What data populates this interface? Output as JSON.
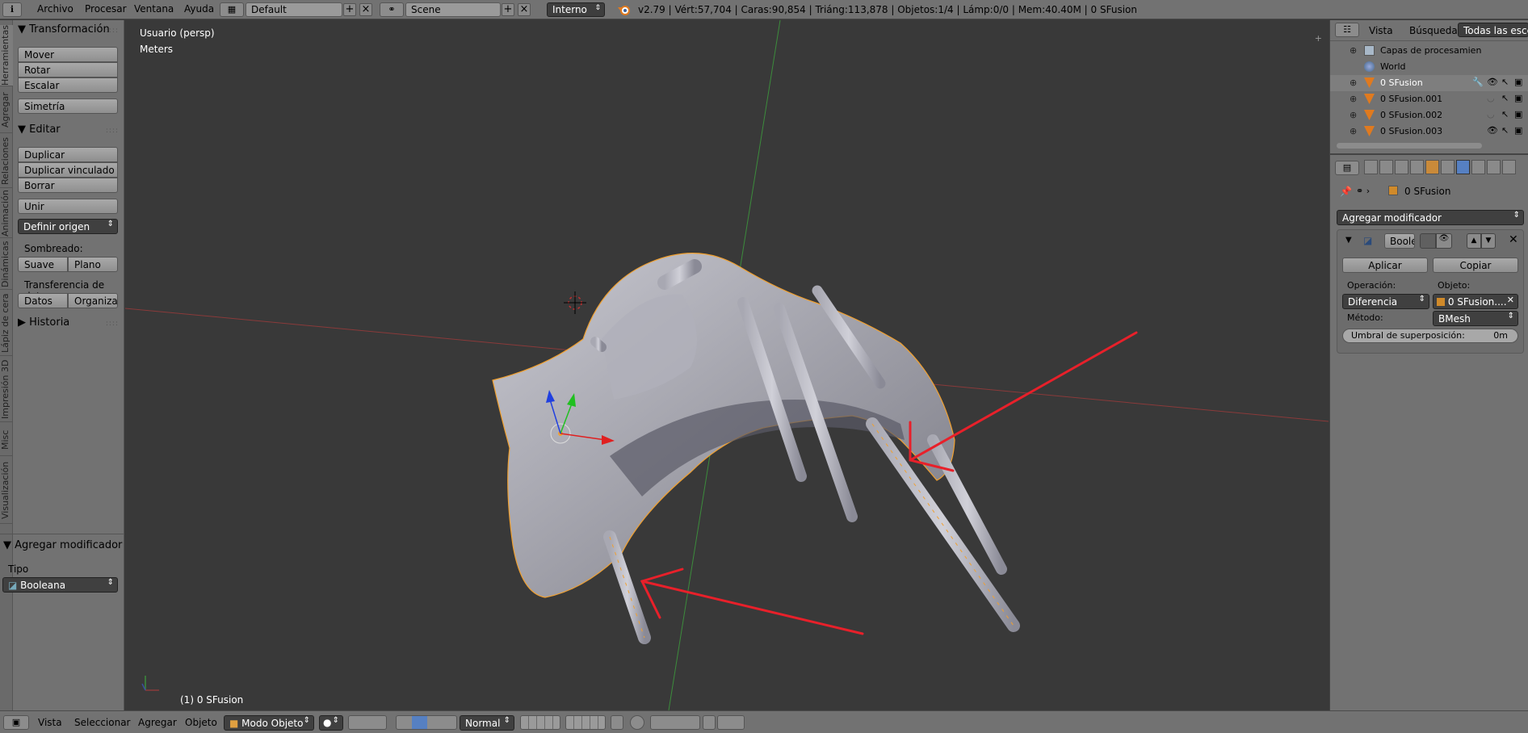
{
  "topbar": {
    "menus": [
      "Archivo",
      "Procesar",
      "Ventana",
      "Ayuda"
    ],
    "layout": "Default",
    "scene": "Scene",
    "engine": "Interno",
    "stats": "v2.79 | Vért:57,704 | Caras:90,854 | Triáng:113,878 | Objetos:1/4 | Lámp:0/0 | Mem:40.40M | 0 SFusion"
  },
  "left_tabs": [
    "Herramientas",
    "Agregar",
    "Relaciones",
    "Animación",
    "Dinámicas",
    "Lápiz de cera",
    "Impresión 3D",
    "Misc",
    "Visualización"
  ],
  "toolshelf": {
    "transform_title": "Transformación",
    "transform_buttons": [
      "Mover",
      "Rotar",
      "Escalar"
    ],
    "mirror": "Simetría",
    "edit_title": "Editar",
    "edit_buttons": [
      "Duplicar",
      "Duplicar vinculado",
      "Borrar"
    ],
    "join": "Unir",
    "set_origin": "Definir origen",
    "shading_label": "Sombreado:",
    "smooth": "Suave",
    "flat": "Plano",
    "data_transfer_label": "Transferencia de datos:",
    "data": "Datos",
    "organize": "Organizaci",
    "history_title": "Historia",
    "operator_title": "Agregar modificador",
    "type_label": "Tipo",
    "type_value": "Booleana"
  },
  "viewport": {
    "view_name": "Usuario (persp)",
    "units": "Meters",
    "object_label": "(1) 0 SFusion"
  },
  "outliner": {
    "tabs": [
      "Vista",
      "Búsqueda",
      "Todas las escen"
    ],
    "items": [
      {
        "label": "Capas de procesamien"
      },
      {
        "label": "World"
      },
      {
        "label": "0 SFusion"
      },
      {
        "label": "0 SFusion.001"
      },
      {
        "label": "0 SFusion.002"
      },
      {
        "label": "0 SFusion.003"
      }
    ]
  },
  "properties": {
    "breadcrumb": "0 SFusion",
    "add_modifier": "Agregar modificador",
    "modifier_name": "Boole",
    "apply": "Aplicar",
    "copy": "Copiar",
    "operation_label": "Operación:",
    "operation_value": "Diferencia",
    "object_label": "Objeto:",
    "object_value": "0 SFusion....",
    "method_label": "Método:",
    "method_value": "BMesh",
    "overlap_label": "Umbral de superposición:",
    "overlap_value": "0m"
  },
  "bottombar": {
    "menus": [
      "Vista",
      "Seleccionar",
      "Agregar",
      "Objeto"
    ],
    "mode": "Modo Objeto",
    "orientation": "Normal"
  },
  "colors": {
    "panel": "#727272",
    "viewport": "#393939",
    "selected_outline": "#f0a030",
    "annotation_arrow": "#e8202a"
  }
}
